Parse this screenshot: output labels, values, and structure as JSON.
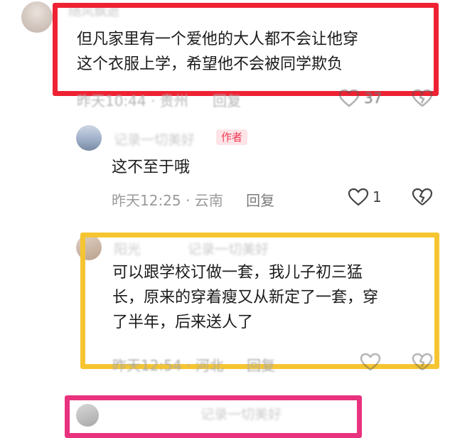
{
  "comments": [
    {
      "username": "随风飘逝",
      "text_lines": [
        "但凡家里有一个爱他的大人都不会让他穿",
        "这个衣服上学，希望他不会被同学欺负"
      ],
      "time": "昨天10:44",
      "location": "贵州",
      "reply_label": "回复",
      "like_count": "37"
    },
    {
      "username": "记录一切美好",
      "author_tag": "作者",
      "text": "这不至于哦",
      "time": "昨天12:25",
      "location": "云南",
      "reply_label": "回复",
      "like_count": "1"
    },
    {
      "username": "阳光",
      "reply_to": "记录一切美好",
      "text_lines": [
        "可以跟学校订做一套，我儿子初三猛",
        "长，原来的穿着瘦又从新定了一套，穿",
        "了半年，后来送人了"
      ],
      "time": "昨天12:54",
      "location": "河北",
      "reply_label": "回复"
    },
    {
      "reply_to": "记录一切美好"
    }
  ],
  "separator": "·",
  "colors": {
    "red_box": "#ee2233",
    "yellow_box": "#f5c531",
    "pink_box": "#e8327e",
    "author_tag_bg": "#fde4e6",
    "author_tag_text": "#f03a56"
  }
}
